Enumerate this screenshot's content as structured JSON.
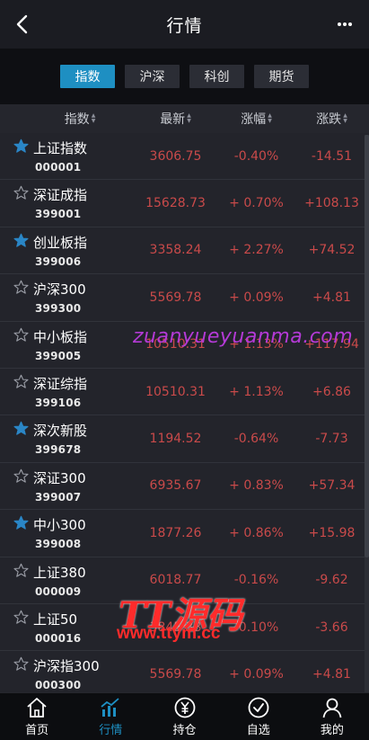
{
  "header": {
    "title": "行情"
  },
  "tabs": [
    {
      "label": "指数",
      "active": true
    },
    {
      "label": "沪深",
      "active": false
    },
    {
      "label": "科创",
      "active": false
    },
    {
      "label": "期货",
      "active": false
    }
  ],
  "columns": {
    "name": "指数",
    "latest": "最新",
    "change_pct": "涨幅",
    "change": "涨跌"
  },
  "rows": [
    {
      "name": "上证指数",
      "code": "000001",
      "latest": "3606.75",
      "pct": "-0.40%",
      "chg": "-14.51",
      "starred": true
    },
    {
      "name": "深证成指",
      "code": "399001",
      "latest": "15628.73",
      "pct": "+ 0.70%",
      "chg": "+108.13",
      "starred": false
    },
    {
      "name": "创业板指",
      "code": "399006",
      "latest": "3358.24",
      "pct": "+ 2.27%",
      "chg": "+74.52",
      "starred": true
    },
    {
      "name": "沪深300",
      "code": "399300",
      "latest": "5569.78",
      "pct": "+ 0.09%",
      "chg": "+4.81",
      "starred": false
    },
    {
      "name": "中小板指",
      "code": "399005",
      "latest": "10510.31",
      "pct": "+ 1.13%",
      "chg": "+117.94",
      "starred": false
    },
    {
      "name": "深证综指",
      "code": "399106",
      "latest": "10510.31",
      "pct": "+ 1.13%",
      "chg": "+6.86",
      "starred": false
    },
    {
      "name": "深次新股",
      "code": "399678",
      "latest": "1194.52",
      "pct": "-0.64%",
      "chg": "-7.73",
      "starred": true
    },
    {
      "name": "深证300",
      "code": "399007",
      "latest": "6935.67",
      "pct": "+ 0.83%",
      "chg": "+57.34",
      "starred": false
    },
    {
      "name": "中小300",
      "code": "399008",
      "latest": "1877.26",
      "pct": "+ 0.86%",
      "chg": "+15.98",
      "starred": true
    },
    {
      "name": "上证380",
      "code": "000009",
      "latest": "6018.77",
      "pct": "-0.16%",
      "chg": "-9.62",
      "starred": false
    },
    {
      "name": "上证50",
      "code": "000016",
      "latest": "3845.38",
      "pct": "-0.10%",
      "chg": "-3.66",
      "starred": false
    },
    {
      "name": "沪深指300",
      "code": "000300",
      "latest": "5569.78",
      "pct": "+ 0.09%",
      "chg": "+4.81",
      "starred": false
    }
  ],
  "watermarks": {
    "site": "zuanyueyuanma.com",
    "brand": "TT源码",
    "url": "www.ttym.cc"
  },
  "bottom_nav": [
    {
      "label": "首页",
      "icon": "home-icon",
      "active": false
    },
    {
      "label": "行情",
      "icon": "chart-icon",
      "active": true
    },
    {
      "label": "持仓",
      "icon": "yen-icon",
      "active": false
    },
    {
      "label": "自选",
      "icon": "check-icon",
      "active": false
    },
    {
      "label": "我的",
      "icon": "user-icon",
      "active": false
    }
  ],
  "colors": {
    "accent": "#1e8fc2",
    "quote_red": "#c94a4a",
    "star_blue": "#2a86c6"
  }
}
